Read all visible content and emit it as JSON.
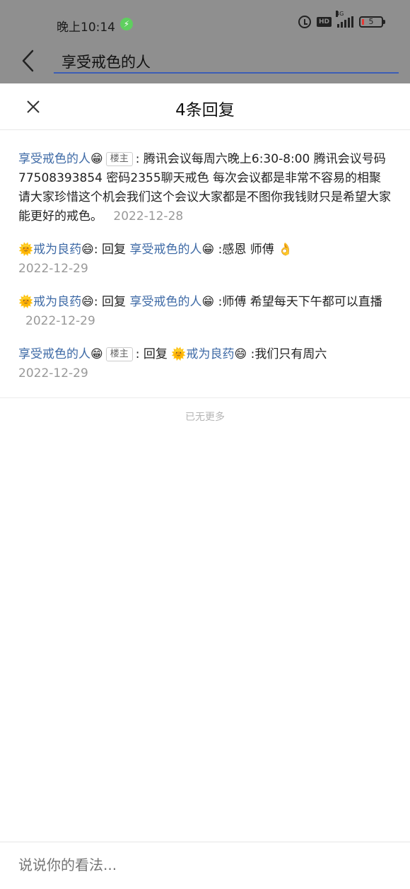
{
  "status_bar": {
    "time": "晚上10:14",
    "hd_label": "HD",
    "network_label": "4G",
    "battery_level": "5"
  },
  "search": {
    "query": "享受戒色的人"
  },
  "sheet": {
    "title": "4条回复"
  },
  "replies": [
    {
      "user": "享受戒色的人",
      "user_emoji": "😁",
      "owner_tag": "楼主",
      "colon": ":",
      "text": "腾讯会议每周六晚上6:30-8:00 腾讯会议号码77508393854 密码2355聊天戒色 每次会议都是非常不容易的相聚请大家珍惜这个机会我们这个会议大家都是不图你我钱财只是希望大家能更好的戒色。",
      "date": "2022-12-28"
    },
    {
      "user_prefix_emoji": "🌞",
      "user": "戒为良药",
      "user_emoji": "😄",
      "colon": ":",
      "reply_label": "回复",
      "target": "享受戒色的人",
      "target_emoji": "😁",
      "text": ":感恩 师傅",
      "text_emoji": "👌",
      "date": "2022-12-29"
    },
    {
      "user_prefix_emoji": "🌞",
      "user": "戒为良药",
      "user_emoji": "😄",
      "colon": ":",
      "reply_label": "回复",
      "target": "享受戒色的人",
      "target_emoji": "😁",
      "text": ":师傅 希望每天下午都可以直播",
      "date": "2022-12-29"
    },
    {
      "user": "享受戒色的人",
      "user_emoji": "😁",
      "owner_tag": "楼主",
      "colon": ":",
      "reply_label": "回复",
      "target_prefix_emoji": "🌞",
      "target": "戒为良药",
      "target_emoji": "😄",
      "text": ":我们只有周六",
      "date": "2022-12-29"
    }
  ],
  "footer": {
    "no_more": "已无更多"
  },
  "comment": {
    "placeholder": "说说你的看法..."
  },
  "colors": {
    "username": "#3e6aa6",
    "search_underline": "#3b5db5",
    "dim_overlay": "#8f8f8f",
    "date_gray": "#999999"
  }
}
